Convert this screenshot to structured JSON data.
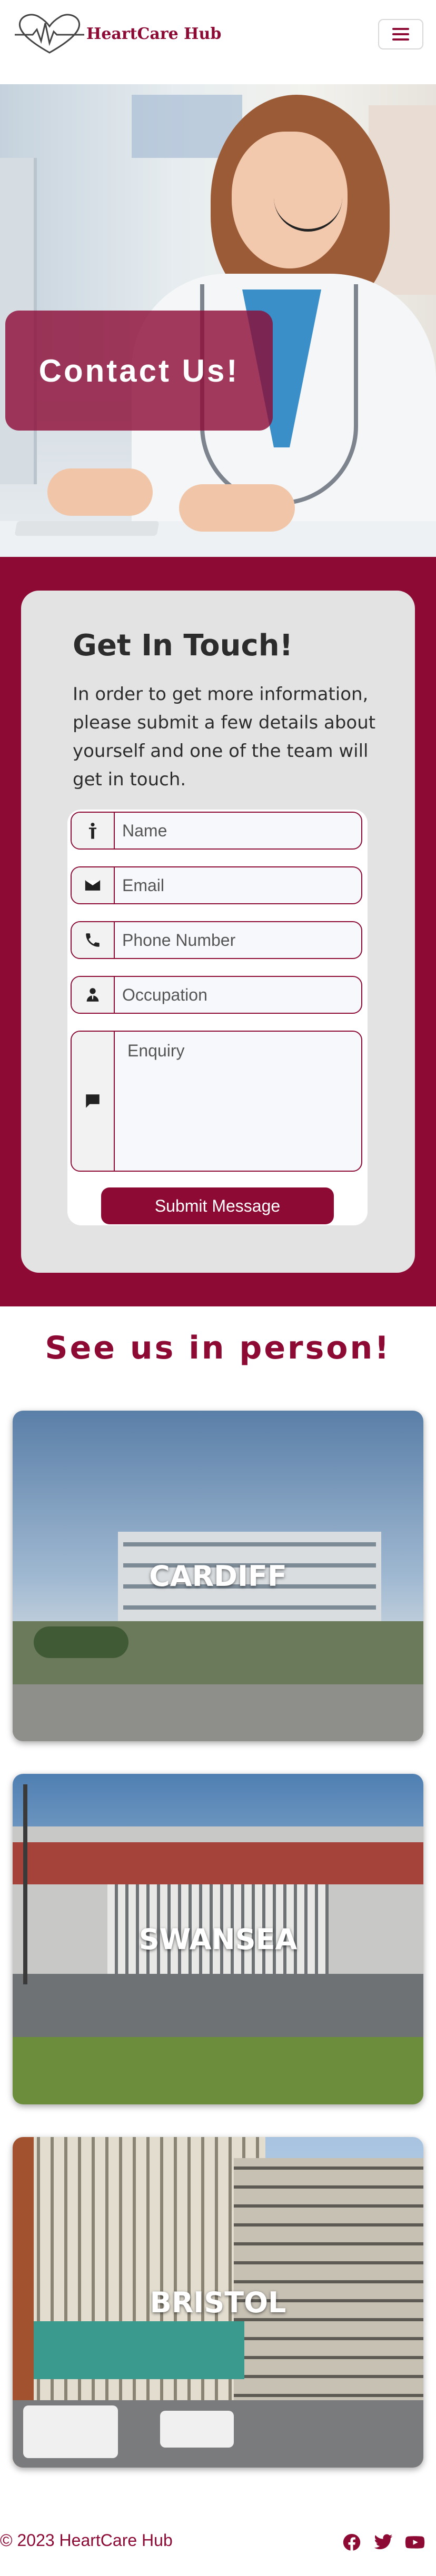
{
  "navbar": {
    "brand_name": "HeartCare Hub",
    "toggle_icon": "hamburger-icon",
    "brand_color": "#8c0a34"
  },
  "hero": {
    "banner_text": "Contact Us!"
  },
  "contact": {
    "heading": "Get In Touch!",
    "intro": "In order to get more information, please submit a few details about yourself and one of the team will get in touch.",
    "fields": {
      "name_placeholder": "Name",
      "email_placeholder": "Email",
      "phone_placeholder": "Phone Number",
      "occupation_placeholder": "Occupation",
      "enquiry_placeholder": "Enquiry"
    },
    "submit_label": "Submit Message"
  },
  "locations": {
    "title": "See us in person!",
    "items": [
      {
        "name": "CARDIFF"
      },
      {
        "name": "SWANSEA"
      },
      {
        "name": "BRISTOL"
      }
    ]
  },
  "footer": {
    "copyright": "© 2023 HeartCare Hub",
    "social_icons": [
      "facebook-icon",
      "twitter-icon",
      "youtube-icon"
    ]
  }
}
